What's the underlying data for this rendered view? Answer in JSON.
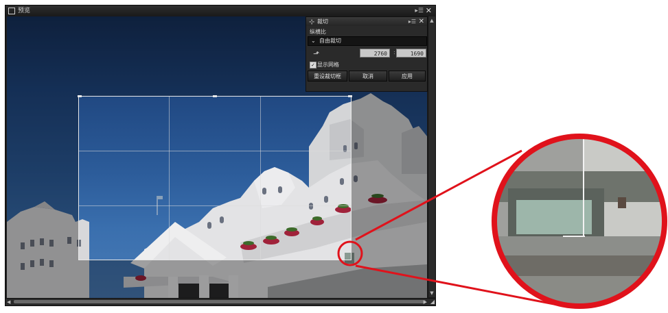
{
  "window": {
    "title": "预览"
  },
  "crop_panel": {
    "title": "裁切",
    "aspect_label": "纵横比",
    "aspect_value": "自由裁切",
    "width_value": "2760",
    "height_value": "1690",
    "separator": ":",
    "show_grid_label": "显示网格",
    "show_grid_checked": true,
    "reset_button": "重设裁切框",
    "cancel_button": "取消",
    "apply_button": "应用"
  },
  "colors": {
    "highlight_ring": "#e0121b",
    "panel_bg": "#2a2a2a",
    "sky": "#2c5c9a"
  },
  "icons": {
    "window": "window-icon",
    "crop": "crop-icon",
    "rotate": "rotate-orientation-icon",
    "menu": "panel-menu-icon",
    "close": "close-icon"
  }
}
